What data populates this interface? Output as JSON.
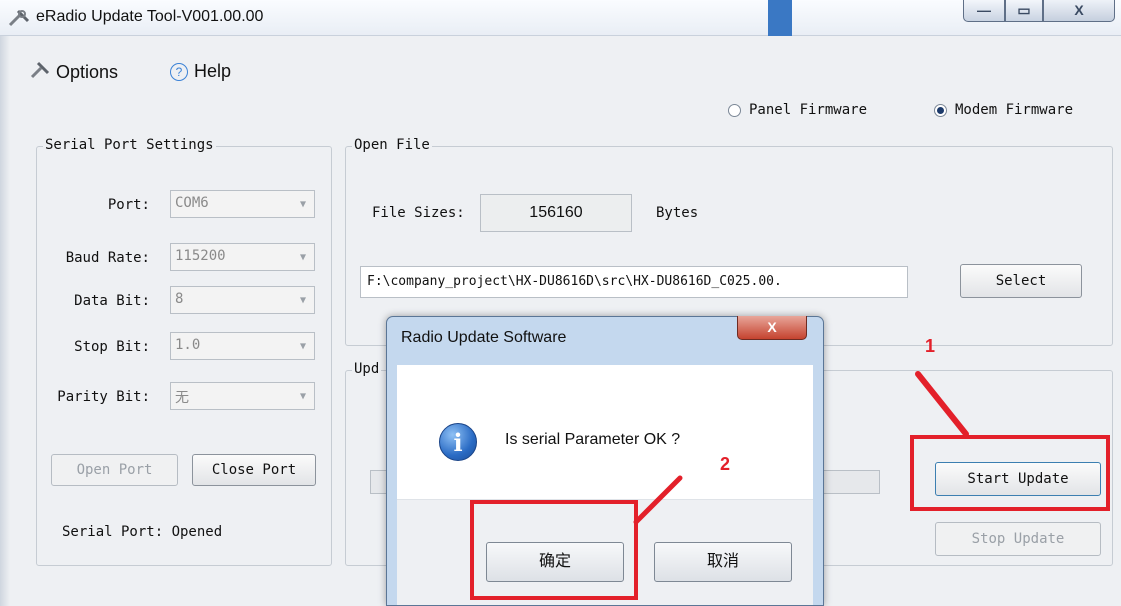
{
  "window": {
    "title": "eRadio Update Tool-V001.00.00"
  },
  "menu": {
    "options": "Options",
    "help": "Help",
    "help_icon": "?"
  },
  "firmware": {
    "panel": "Panel Firmware",
    "modem": "Modem Firmware",
    "selected": "modem"
  },
  "serial": {
    "group_title": "Serial Port Settings",
    "fields": [
      {
        "label": "Port:",
        "value": "COM6"
      },
      {
        "label": "Baud Rate:",
        "value": "115200"
      },
      {
        "label": "Data Bit:",
        "value": "8"
      },
      {
        "label": "Stop Bit:",
        "value": "1.0"
      },
      {
        "label": "Parity Bit:",
        "value": "无"
      }
    ],
    "open_port": "Open Port",
    "close_port": "Close Port",
    "status": "Serial Port: Opened"
  },
  "open_file": {
    "group_title": "Open File",
    "size_label": "File Sizes:",
    "size_value": "156160",
    "size_unit": "Bytes",
    "path": "F:\\company_project\\HX-DU8616D\\src\\HX-DU8616D_C025.00.",
    "select": "Select"
  },
  "update": {
    "group_title": "Upd",
    "start": "Start Update",
    "stop": "Stop Update"
  },
  "dialog": {
    "title": "Radio Update Software",
    "close": "X",
    "info_icon": "i",
    "message": "Is serial Parameter OK ?",
    "ok": "确定",
    "cancel": "取消"
  },
  "annotations": {
    "first": "1",
    "second": "2"
  },
  "colors": {
    "annotation_red": "#e3202a",
    "accent_blue": "#3a78c4"
  }
}
